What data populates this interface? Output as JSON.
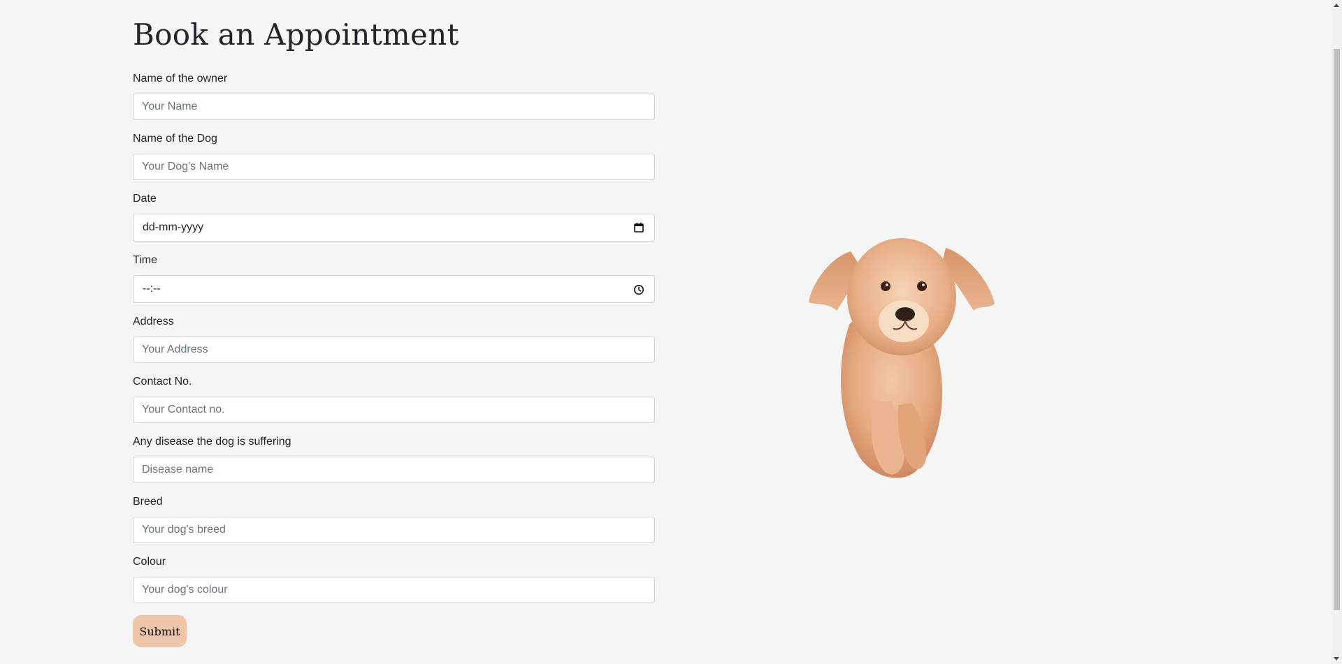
{
  "page": {
    "heading": "Book an Appointment"
  },
  "form": {
    "fields": [
      {
        "label": "Name of the owner",
        "placeholder": "Your Name",
        "type": "text"
      },
      {
        "label": "Name of the Dog",
        "placeholder": "Your Dog's Name",
        "type": "text"
      },
      {
        "label": "Date",
        "value_display": "dd-mm-yyyy",
        "type": "date",
        "icon": "calendar-icon"
      },
      {
        "label": "Time",
        "value_display": "--:--",
        "type": "time",
        "icon": "clock-icon"
      },
      {
        "label": "Address",
        "placeholder": "Your Address",
        "type": "text"
      },
      {
        "label": "Contact No.",
        "placeholder": "Your Contact no.",
        "type": "text"
      },
      {
        "label": "Any disease the dog is suffering",
        "placeholder": "Disease name",
        "type": "text"
      },
      {
        "label": "Breed",
        "placeholder": "Your dog's breed",
        "type": "text"
      },
      {
        "label": "Colour",
        "placeholder": "Your dog's colour",
        "type": "text"
      }
    ],
    "submit_label": "Submit"
  },
  "image": {
    "subject": "golden-retriever-puppy"
  },
  "colors": {
    "background": "#f5f5f5",
    "submit_button": "#f0c6aa",
    "input_border": "#ced4da"
  }
}
